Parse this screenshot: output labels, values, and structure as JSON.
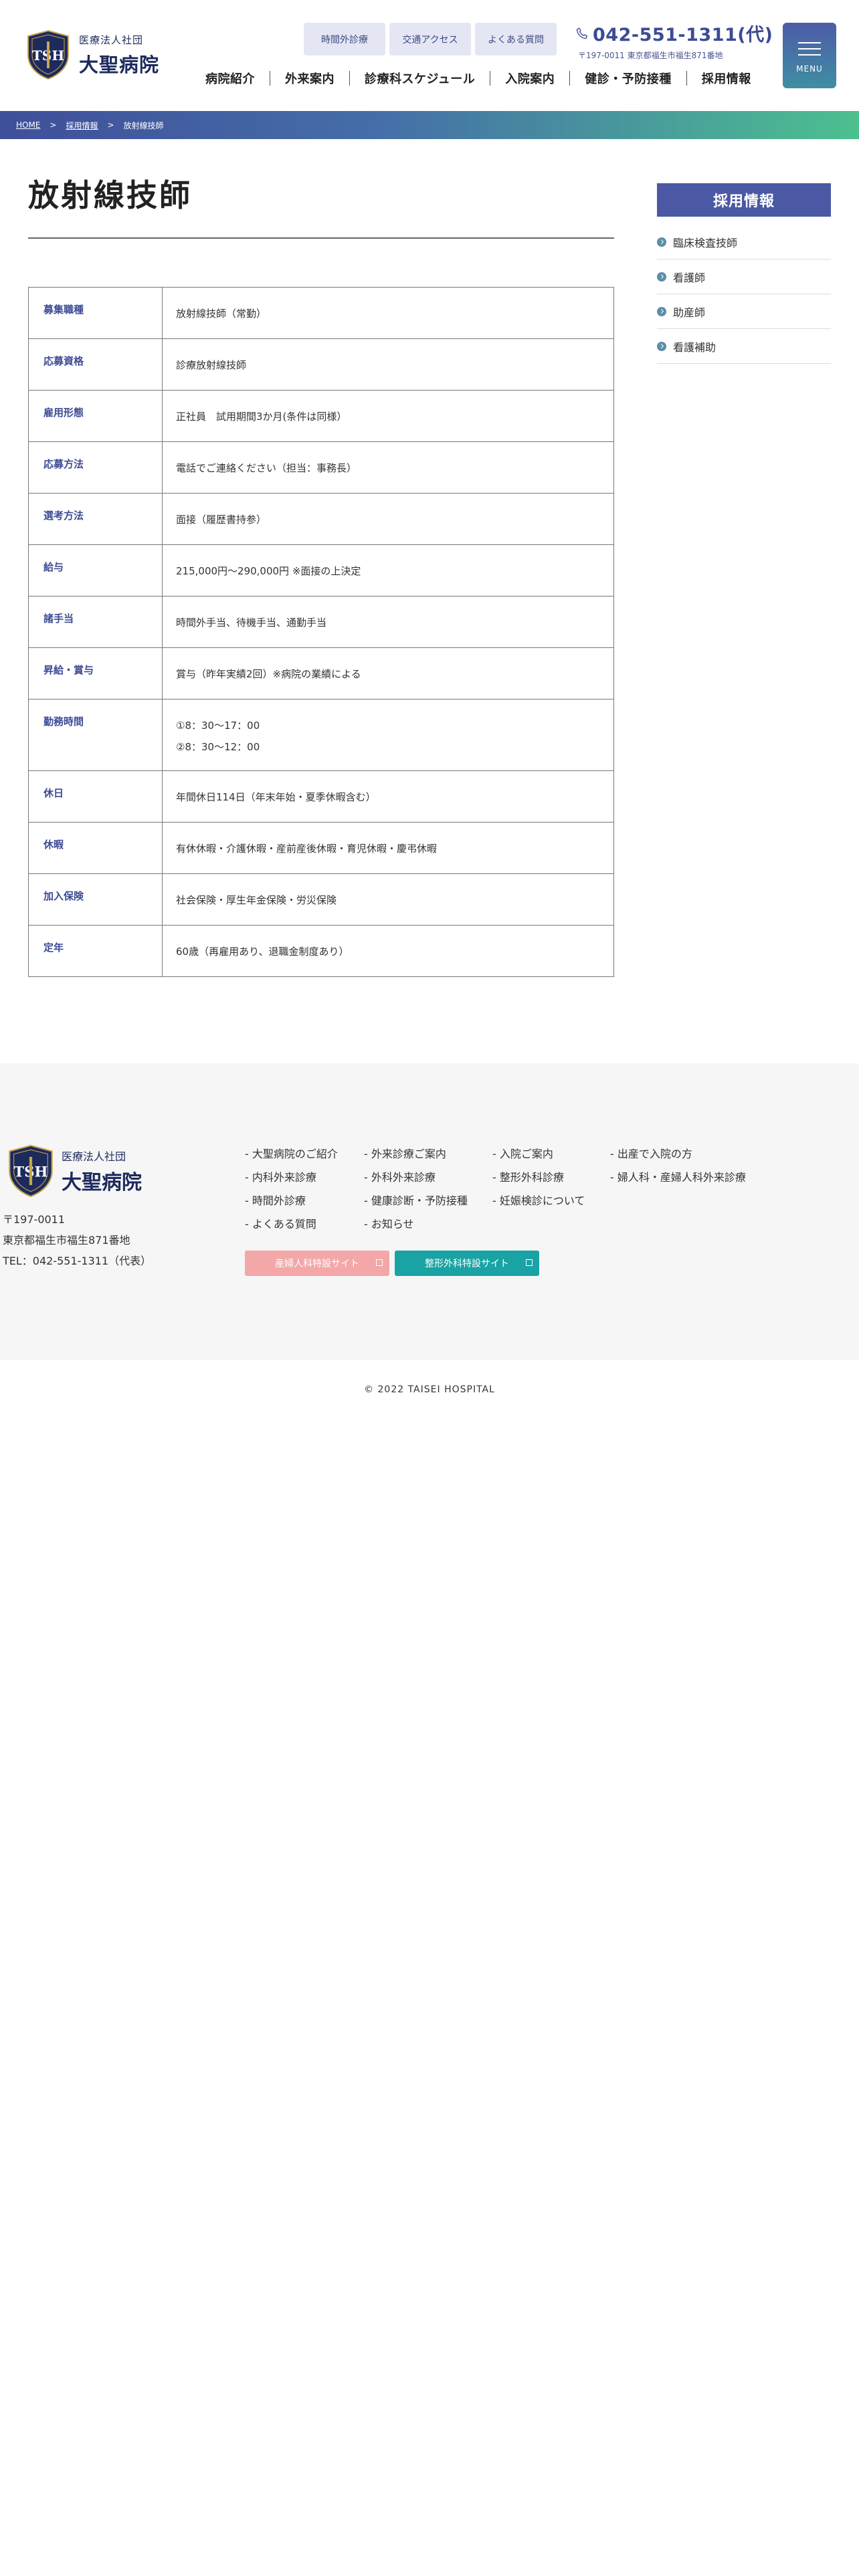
{
  "header": {
    "logo": {
      "corp": "医療法人社団",
      "name": "大聖病院",
      "mark": "TSH"
    },
    "top_links": [
      "時間外診療",
      "交通アクセス",
      "よくある質問"
    ],
    "phone": "042-551-1311(代)",
    "address": "〒197-0011 東京都福生市福生871番地",
    "menu_label": "MENU",
    "nav": [
      "病院紹介",
      "外来案内",
      "診療科スケジュール",
      "入院案内",
      "健診・予防接種",
      "採用情報"
    ]
  },
  "breadcrumb": {
    "home": "HOME",
    "parent": "採用情報",
    "current": "放射線技師",
    "separator": ">"
  },
  "main": {
    "title": "放射線技師",
    "rows": [
      {
        "label": "募集職種",
        "lines": [
          "放射線技師（常勤）"
        ]
      },
      {
        "label": "応募資格",
        "lines": [
          "診療放射線技師"
        ]
      },
      {
        "label": "雇用形態",
        "lines": [
          "正社員　試用期間3か月(条件は同様）"
        ]
      },
      {
        "label": "応募方法",
        "lines": [
          "電話でご連絡ください（担当：事務長）"
        ]
      },
      {
        "label": "選考方法",
        "lines": [
          "面接（履歴書持参）"
        ]
      },
      {
        "label": "給与",
        "lines": [
          "215,000円〜290,000円 ※面接の上決定"
        ]
      },
      {
        "label": "諸手当",
        "lines": [
          "時間外手当、待機手当、通勤手当"
        ]
      },
      {
        "label": "昇給・賞与",
        "lines": [
          "賞与（昨年実績2回）※病院の業績による"
        ]
      },
      {
        "label": "勤務時間",
        "lines": [
          "①8：30〜17：00",
          "②8：30〜12：00"
        ]
      },
      {
        "label": "休日",
        "lines": [
          "年間休日114日（年末年始・夏季休暇含む）"
        ]
      },
      {
        "label": "休暇",
        "lines": [
          "有休休暇・介護休暇・産前産後休暇・育児休暇・慶弔休暇"
        ]
      },
      {
        "label": "加入保険",
        "lines": [
          "社会保険・厚生年金保険・労災保険"
        ]
      },
      {
        "label": "定年",
        "lines": [
          "60歳（再雇用あり、退職金制度あり）"
        ]
      }
    ]
  },
  "sidebar": {
    "title": "採用情報",
    "items": [
      "臨床検査技師",
      "看護師",
      "助産師",
      "看護補助"
    ]
  },
  "footer": {
    "logo": {
      "corp": "医療法人社団",
      "name": "大聖病院"
    },
    "address_lines": [
      "〒197-0011",
      "東京都福生市福生871番地",
      "TEL：042-551-1311（代表）"
    ],
    "links": [
      "- 大聖病院のご紹介",
      "- 外来診療ご案内",
      "- 入院ご案内",
      "- 出産で入院の方",
      "- 内科外来診療",
      "- 外科外来診療",
      "- 整形外科診療",
      "- 婦人科・産婦人科外来診療",
      "- 時間外診療",
      "- 健康診断・予防接種",
      "- 妊娠検診について",
      "- よくある質問",
      "- お知らせ"
    ],
    "buttons": [
      "産婦人科特設サイト",
      "整形外科特設サイト"
    ]
  },
  "copyright": "© 2022 TAISEI HOSPITAL",
  "colors": {
    "brand_navy": "#3d4b94",
    "gradient_start": "#3f4f9a",
    "gradient_end": "#4cc08f",
    "pink": "#f3a7a8",
    "teal": "#1aa3a4"
  }
}
